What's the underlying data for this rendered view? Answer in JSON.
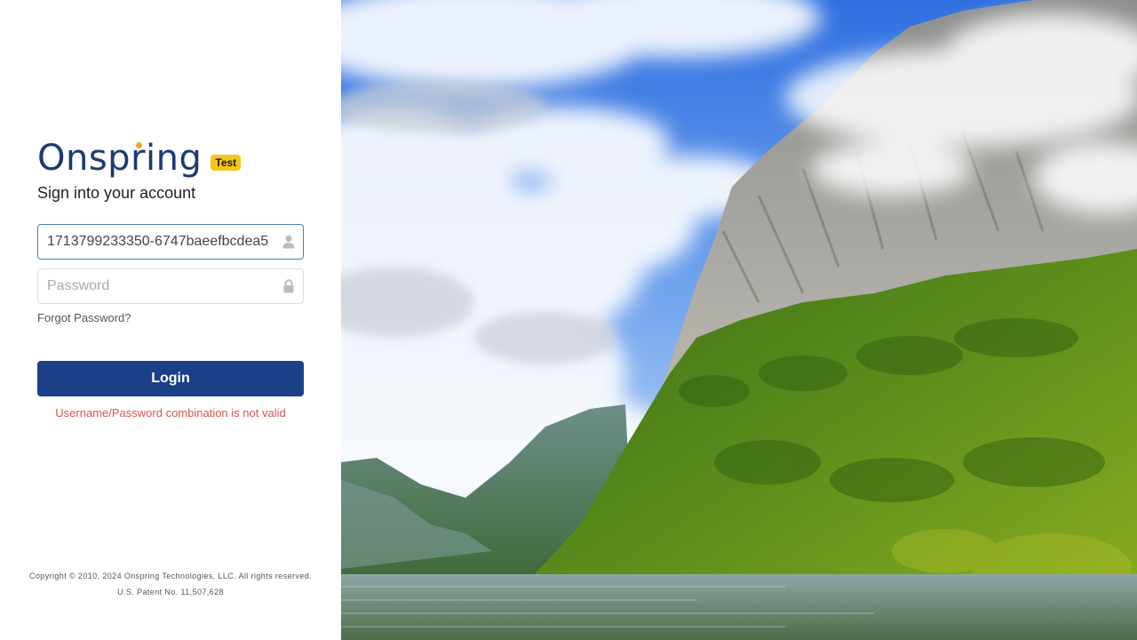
{
  "logo": {
    "text": "Onspring",
    "badge": "Test"
  },
  "heading": "Sign into your account",
  "username": {
    "value": "1713799233350-6747baeefbcdea5",
    "icon": "user-icon"
  },
  "password": {
    "placeholder": "Password",
    "value": "",
    "icon": "lock-icon"
  },
  "forgot_password": "Forgot Password?",
  "login_button": "Login",
  "error_message": "Username/Password combination is not valid",
  "footer": {
    "copyright": "Copyright © 2010, 2024 Onspring Technologies, LLC. All rights reserved.",
    "patent": "U.S. Patent No. 11,507,628"
  },
  "colors": {
    "brand_navy": "#1b3a72",
    "button": "#1b4088",
    "badge": "#f5c518",
    "error": "#d9534f",
    "accent_dot": "#f5a623"
  }
}
